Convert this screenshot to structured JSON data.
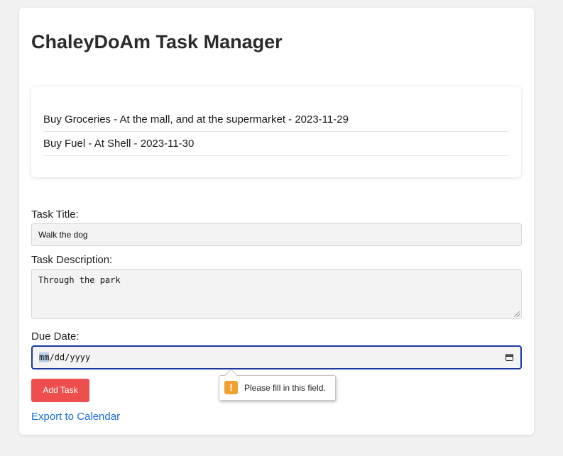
{
  "app": {
    "title": "ChaleyDoAm Task Manager"
  },
  "tasks": [
    {
      "text": "Buy Groceries - At the mall, and at the supermarket - 2023-11-29"
    },
    {
      "text": "Buy Fuel - At Shell - 2023-11-30"
    }
  ],
  "form": {
    "title_label": "Task Title:",
    "title_value": "Walk the dog",
    "description_label": "Task Description:",
    "description_value": "Through the park",
    "due_label": "Due Date:",
    "due_placeholder_segment_mm": "mm",
    "due_placeholder_rest": "/dd/yyyy",
    "add_button_label": "Add Task",
    "export_link_label": "Export to Calendar"
  },
  "validation": {
    "icon": "warning-icon",
    "icon_glyph": "!",
    "message": "Please fill in this field."
  },
  "colors": {
    "accent_button": "#ee4e4e",
    "link": "#1a6fe0",
    "focus_border": "#1b3a9e",
    "warning": "#f0a030"
  }
}
